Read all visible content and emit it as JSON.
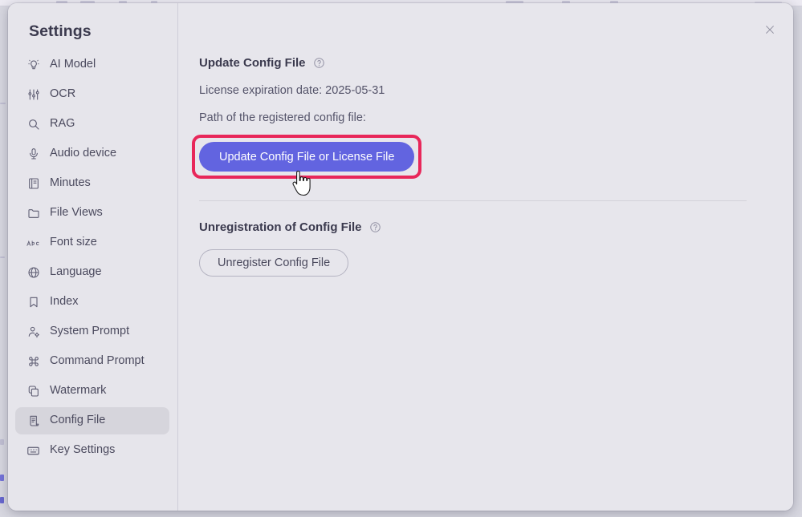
{
  "window": {
    "dialog_title": "Settings",
    "close_label": "×"
  },
  "sidebar": {
    "title": "Settings",
    "items": [
      {
        "label": "AI Model",
        "icon": "lightbulb-icon",
        "selected": false
      },
      {
        "label": "OCR",
        "icon": "sliders-icon",
        "selected": false
      },
      {
        "label": "RAG",
        "icon": "search-icon",
        "selected": false
      },
      {
        "label": "Audio device",
        "icon": "microphone-icon",
        "selected": false
      },
      {
        "label": "Minutes",
        "icon": "book-icon",
        "selected": false
      },
      {
        "label": "File Views",
        "icon": "folder-icon",
        "selected": false
      },
      {
        "label": "Font size",
        "icon": "abc-icon",
        "selected": false
      },
      {
        "label": "Language",
        "icon": "globe-icon",
        "selected": false
      },
      {
        "label": "Index",
        "icon": "bookmark-icon",
        "selected": false
      },
      {
        "label": "System Prompt",
        "icon": "user-gear-icon",
        "selected": false
      },
      {
        "label": "Command Prompt",
        "icon": "command-icon",
        "selected": false
      },
      {
        "label": "Watermark",
        "icon": "copy-layers-icon",
        "selected": false
      },
      {
        "label": "Config File",
        "icon": "scroll-icon",
        "selected": true
      },
      {
        "label": "Key Settings",
        "icon": "keyboard-icon",
        "selected": false
      }
    ]
  },
  "main": {
    "update_section": {
      "heading": "Update Config File",
      "help_tooltip": "?",
      "license_line": "License expiration date: 2025-05-31",
      "path_line": "Path of the registered config file:",
      "button_label": "Update Config File or License File"
    },
    "unregister_section": {
      "heading": "Unregistration of Config File",
      "help_tooltip": "?",
      "button_label": "Unregister Config File"
    }
  },
  "colors": {
    "accent_primary": "#6264e0",
    "highlight_ring": "#e8275a",
    "dialog_background": "#e7e6ec",
    "sidebar_background": "#e6e5eb",
    "selected_item": "#d6d5dc",
    "text_primary": "#3b3a4e",
    "text_secondary": "#55546a"
  }
}
